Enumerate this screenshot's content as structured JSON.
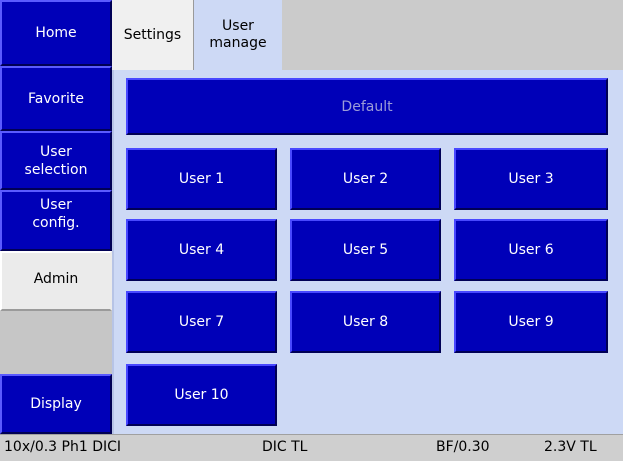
{
  "nav": {
    "home": "Home",
    "favorite": "Favorite",
    "user_selection_line1": "User",
    "user_selection_line2": "selection",
    "user_config_line1": "User",
    "user_config_line2": "config.",
    "admin": "Admin",
    "display": "Display"
  },
  "tabs": {
    "settings": "Settings",
    "user_manage_line1": "User",
    "user_manage_line2": "manage"
  },
  "users": {
    "default": "Default",
    "u1": "User 1",
    "u2": "User 2",
    "u3": "User 3",
    "u4": "User 4",
    "u5": "User 5",
    "u6": "User 6",
    "u7": "User 7",
    "u8": "User 8",
    "u9": "User 9",
    "u10": "User 10"
  },
  "status": {
    "objective": "10x/0.3 Ph1 DICI",
    "dic": "DIC TL",
    "bf": "BF/0.30",
    "lamp": "2.3V TL"
  },
  "colors": {
    "button_blue": "#0000b8",
    "panel_bg": "#cdd9f5",
    "active_nav": "#ebebeb",
    "status_bg": "#cfcfcf"
  }
}
